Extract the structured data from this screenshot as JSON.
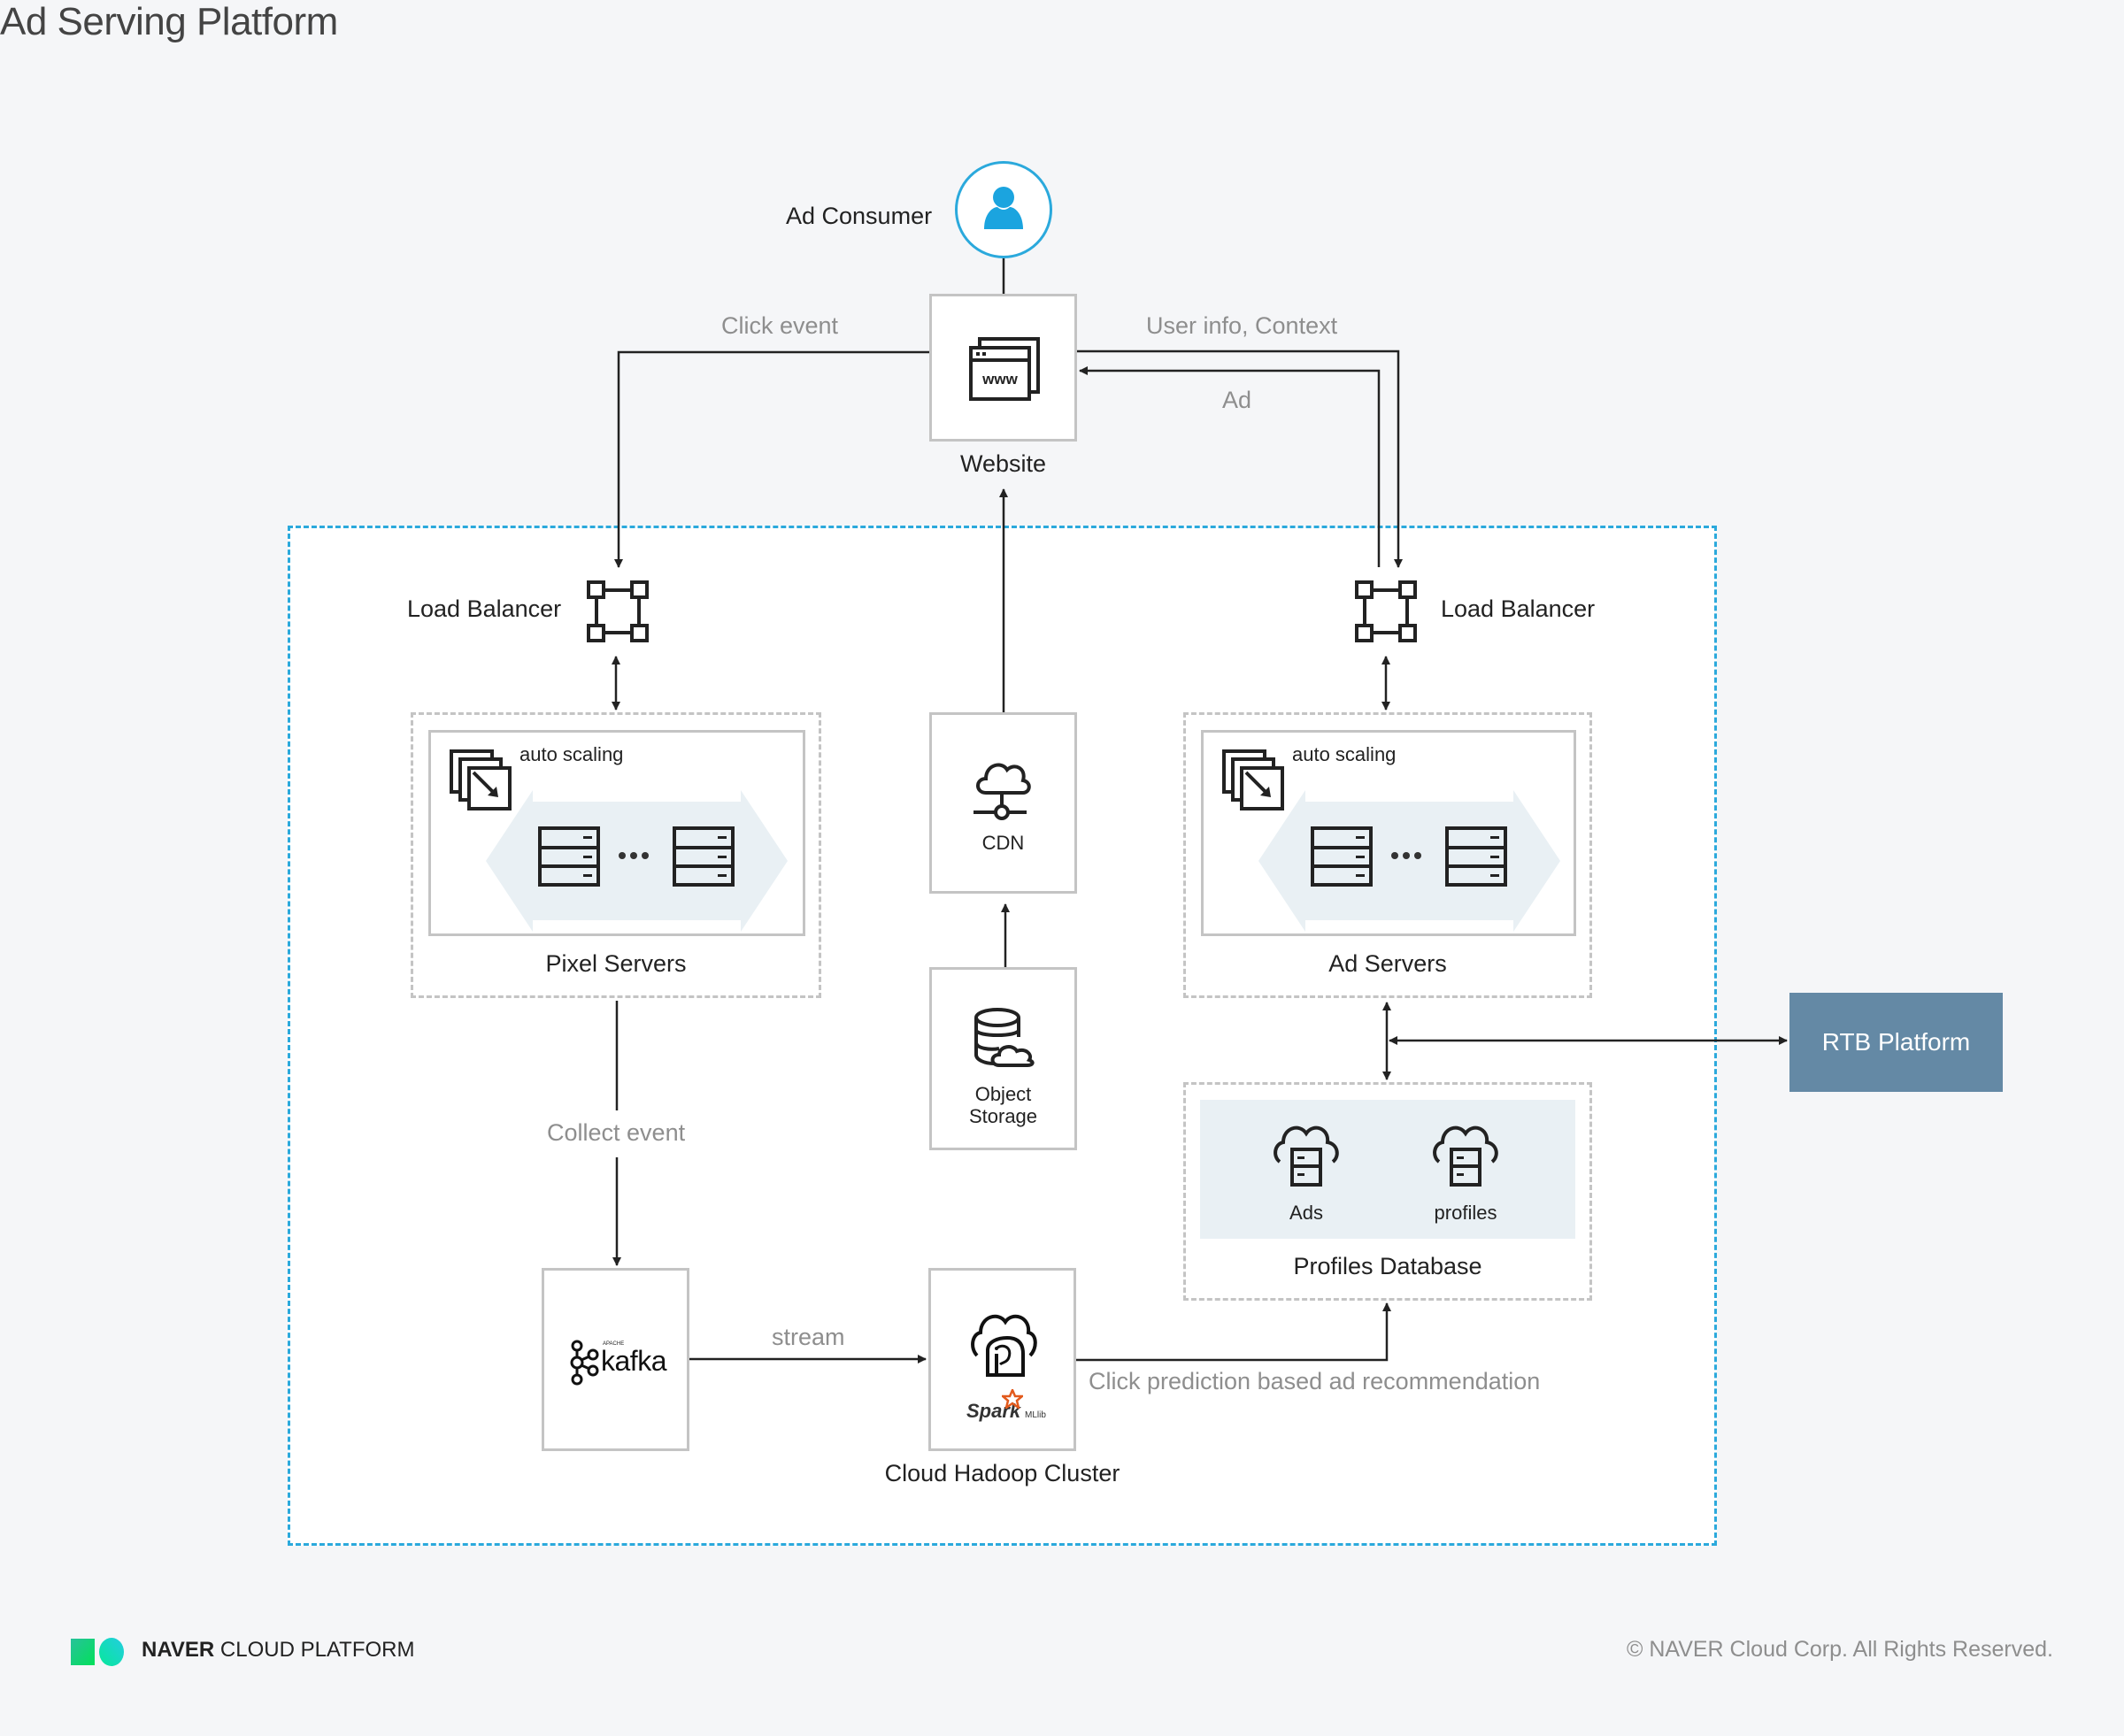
{
  "title": "Ad Serving Platform",
  "nodes": {
    "ad_consumer": "Ad Consumer",
    "website": "Website",
    "load_balancer_left": "Load Balancer",
    "load_balancer_right": "Load Balancer",
    "pixel_servers": {
      "title": "Pixel Servers",
      "auto_scaling": "auto scaling"
    },
    "ad_servers": {
      "title": "Ad Servers",
      "auto_scaling": "auto scaling"
    },
    "cdn": "CDN",
    "object_storage": [
      "Object",
      "Storage"
    ],
    "rtb_platform": "RTB Platform",
    "profiles_database": {
      "title": "Profiles Database",
      "items": [
        "Ads",
        "profiles"
      ]
    },
    "kafka": {
      "small": "APACHE",
      "name": "kafka"
    },
    "hadoop": {
      "title": "Cloud Hadoop Cluster",
      "spark": "Spark",
      "mllib": "MLlib"
    }
  },
  "flows": {
    "click_event": "Click event",
    "user_info_context": "User info, Context",
    "ad": "Ad",
    "collect_event": "Collect event",
    "stream": "stream",
    "click_prediction": "Click prediction based ad recommendation"
  },
  "colors": {
    "accent_blue": "#2ba9dc",
    "rtb_fill": "#6489a5",
    "background": "#f5f6f8",
    "scaling_band": "#e9f0f4"
  },
  "footer": {
    "brand_bold": "NAVER",
    "brand_rest": " CLOUD PLATFORM",
    "copyright": "© NAVER Cloud Corp. All Rights Reserved."
  }
}
